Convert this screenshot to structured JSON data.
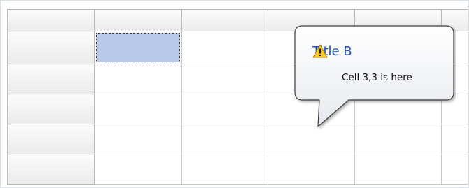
{
  "tooltip": {
    "title": "Title B",
    "text": "Cell 3,3 is here",
    "icon": "warning-icon",
    "title_color": "#1e4fb8"
  },
  "grid": {
    "selection_color": "#b7cbe9"
  }
}
